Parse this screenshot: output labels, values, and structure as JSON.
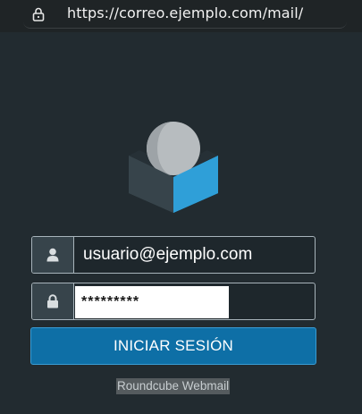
{
  "browser": {
    "url": "https://correo.ejemplo.com/mail/",
    "lock_icon": "lock-icon"
  },
  "login": {
    "logo_icon": "roundcube-logo-icon",
    "username": {
      "icon": "user-icon",
      "value": "usuario@ejemplo.com"
    },
    "password": {
      "icon": "lock-icon",
      "value": "*********"
    },
    "submit_label": "INICIAR SESIÓN"
  },
  "footer": {
    "brand": "Roundcube Webmail"
  },
  "colors": {
    "background": "#222b30",
    "accent": "#0e6fa6",
    "logo_blue": "#2f9fd8",
    "logo_dark": "#37444b"
  }
}
